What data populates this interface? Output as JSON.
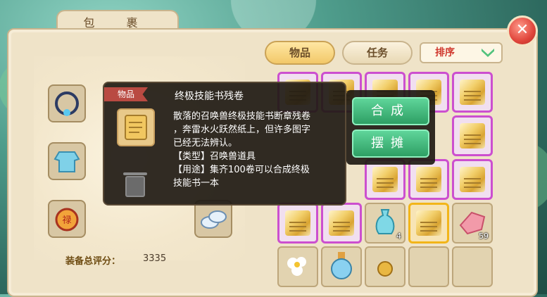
{
  "window": {
    "title": "包 裹",
    "close_label": "✕"
  },
  "tabs": [
    {
      "label": "物品",
      "active": true
    },
    {
      "label": "任务",
      "active": false
    }
  ],
  "sort": {
    "label": "排序"
  },
  "equipment": {
    "score_label": "装备总评分：",
    "score_value": "3335"
  },
  "tooltip": {
    "tag": "物品",
    "title": "终极技能书残卷",
    "desc_lines": [
      "散落的召唤兽终极技能书断章残卷",
      "，奔雷水火跃然纸上，但许多图字",
      "已经无法辨认。",
      "【类型】召唤兽道具",
      "【用途】集齐100卷可以合成终极",
      "技能书一本"
    ]
  },
  "actions": {
    "combine_label": "合成",
    "stall_label": "摆摊"
  },
  "inventory_counts": {
    "vase": "4",
    "crystal": "59"
  },
  "colors": {
    "accent_green": "#2e9f64",
    "close_red": "#e0453b",
    "rare_border": "#cc4fcf",
    "selected_border": "#f2b519"
  }
}
